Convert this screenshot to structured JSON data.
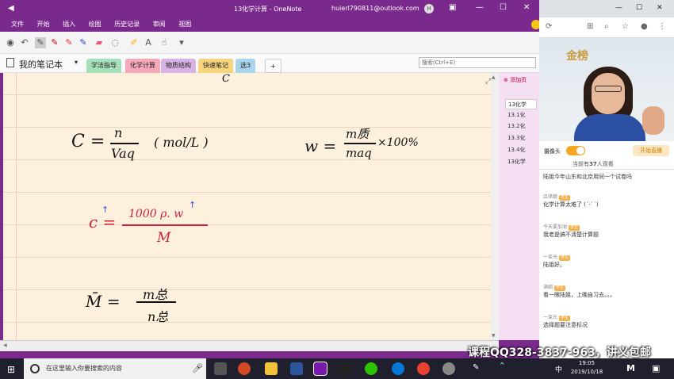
{
  "onenote": {
    "title": "13化学计算 - OneNote",
    "account": "huierl790811@outlook.com",
    "account_initial": "H",
    "menu": [
      "文件",
      "开始",
      "插入",
      "绘图",
      "历史记录",
      "审阅",
      "视图"
    ],
    "notebook_name": "我的笔记本",
    "section_tabs": [
      {
        "label": "学法指导",
        "color": "#a6e0b8"
      },
      {
        "label": "化学计算",
        "color": "#f5a9b8"
      },
      {
        "label": "物质结构",
        "color": "#d7b3e6"
      },
      {
        "label": "快速笔记",
        "color": "#f7d57f"
      },
      {
        "label": "选3",
        "color": "#a8d5ec"
      },
      {
        "label": "+",
        "color": "#fafafa"
      }
    ],
    "search_placeholder": "搜索(Ctrl+E)",
    "add_page_label": "添加页",
    "pages": [
      "13化学",
      "13.1化",
      "13.2化",
      "13.3化",
      "13.4化",
      "13化学"
    ],
    "ink": {
      "top_c": "C",
      "formula1": "C = n / Vₐq  (mol/L)",
      "formula1_num": "n",
      "formula1_den": "Vaq",
      "formula1_unit": "( mol/L )",
      "formula2_lhs": "w =",
      "formula2_num": "m质",
      "formula2_den": "maq",
      "formula2_tail": "×100%",
      "formula3_lhs": "c =",
      "formula3_num": "1000 ρ. w",
      "formula3_den": "M",
      "formula4_lhs": "M̄ =",
      "formula4_num": "m总",
      "formula4_den": "n总"
    }
  },
  "live": {
    "camera_label": "摄像头",
    "start_live_label": "开始直播",
    "viewers_prefix": "当前有",
    "viewers_count": "37",
    "viewers_suffix": "人观看",
    "logo_text": "金榜",
    "messages": [
      {
        "user": "",
        "badge": "",
        "text": "陆姐今年山东和北京用同一个试卷吗"
      },
      {
        "user": "吕琪娜",
        "badge": "学生",
        "text": "化学计算太难了 (´-ˋ´)"
      },
      {
        "user": "今天要加油",
        "badge": "学生",
        "text": "我老是搞不清楚计算题"
      },
      {
        "user": "一束光",
        "badge": "学生",
        "text": "陆姐好。"
      },
      {
        "user": "满纲",
        "badge": "学生",
        "text": "看一眼陆姐，上晚自习去。。。"
      },
      {
        "user": "一束光",
        "badge": "学生",
        "text": "选择题要注意标况"
      }
    ]
  },
  "taskbar": {
    "search_placeholder": "在这里输入你要搜索的内容",
    "time": "19:05",
    "date": "2019/10/18",
    "ime": "中",
    "watermark": "课程QQ328-3837-963，讲义包邮"
  },
  "colors": {
    "onenote_purple": "#7a2a8c",
    "paper": "#fdf1dd",
    "red_ink": "#d4203a",
    "blue_ink": "#3a4bd6",
    "live_orange": "#f5a623"
  }
}
